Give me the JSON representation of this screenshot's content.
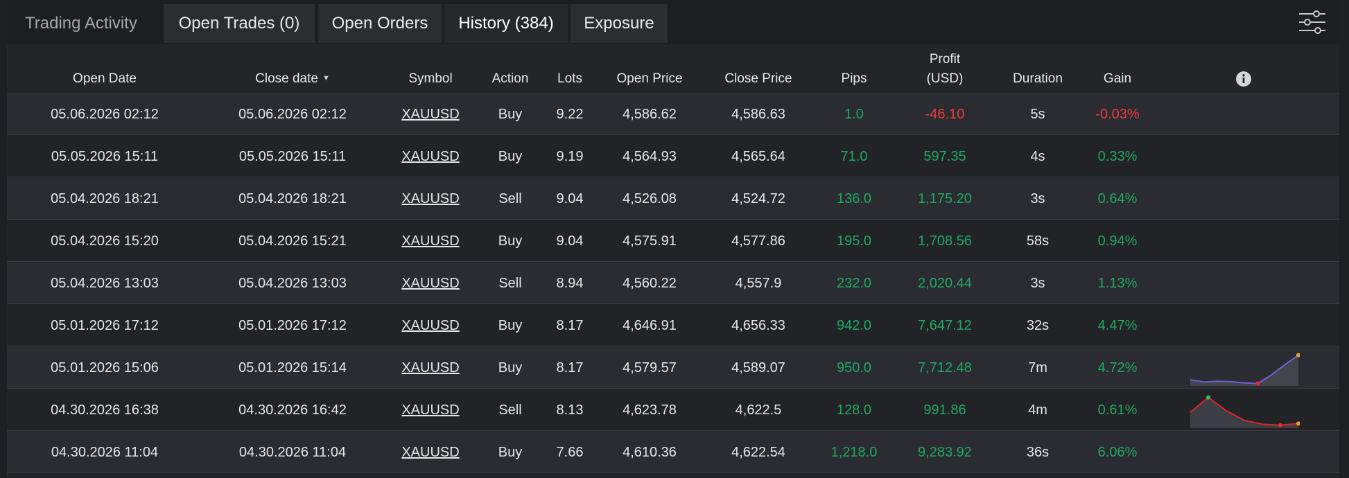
{
  "tabs": {
    "title": "Trading Activity",
    "open_trades": "Open Trades (0)",
    "open_orders": "Open Orders",
    "history": "History (384)",
    "exposure": "Exposure"
  },
  "columns": {
    "open_date": "Open Date",
    "close_date": "Close date",
    "symbol": "Symbol",
    "action": "Action",
    "lots": "Lots",
    "open_price": "Open Price",
    "close_price": "Close Price",
    "pips": "Pips",
    "profit_line1": "Profit",
    "profit_line2": "(USD)",
    "duration": "Duration",
    "gain": "Gain"
  },
  "colors": {
    "positive": "#1fa862",
    "negative": "#ee3b3b",
    "spark_up": "#6b63d9",
    "spark_down": "#d9262b"
  },
  "rows": [
    {
      "open_date": "05.06.2026 02:12",
      "close_date": "05.06.2026 02:12",
      "symbol": "XAUUSD",
      "action": "Buy",
      "lots": "9.22",
      "open_price": "4,586.62",
      "close_price": "4,586.63",
      "pips": "1.0",
      "profit": "-46.10",
      "duration": "5s",
      "gain": "-0.03%",
      "profit_sign": "neg",
      "pips_sign": "pos"
    },
    {
      "open_date": "05.05.2026 15:11",
      "close_date": "05.05.2026 15:11",
      "symbol": "XAUUSD",
      "action": "Buy",
      "lots": "9.19",
      "open_price": "4,564.93",
      "close_price": "4,565.64",
      "pips": "71.0",
      "profit": "597.35",
      "duration": "4s",
      "gain": "0.33%",
      "profit_sign": "pos",
      "pips_sign": "pos"
    },
    {
      "open_date": "05.04.2026 18:21",
      "close_date": "05.04.2026 18:21",
      "symbol": "XAUUSD",
      "action": "Sell",
      "lots": "9.04",
      "open_price": "4,526.08",
      "close_price": "4,524.72",
      "pips": "136.0",
      "profit": "1,175.20",
      "duration": "3s",
      "gain": "0.64%",
      "profit_sign": "pos",
      "pips_sign": "pos"
    },
    {
      "open_date": "05.04.2026 15:20",
      "close_date": "05.04.2026 15:21",
      "symbol": "XAUUSD",
      "action": "Buy",
      "lots": "9.04",
      "open_price": "4,575.91",
      "close_price": "4,577.86",
      "pips": "195.0",
      "profit": "1,708.56",
      "duration": "58s",
      "gain": "0.94%",
      "profit_sign": "pos",
      "pips_sign": "pos"
    },
    {
      "open_date": "05.04.2026 13:03",
      "close_date": "05.04.2026 13:03",
      "symbol": "XAUUSD",
      "action": "Sell",
      "lots": "8.94",
      "open_price": "4,560.22",
      "close_price": "4,557.9",
      "pips": "232.0",
      "profit": "2,020.44",
      "duration": "3s",
      "gain": "1.13%",
      "profit_sign": "pos",
      "pips_sign": "pos"
    },
    {
      "open_date": "05.01.2026 17:12",
      "close_date": "05.01.2026 17:12",
      "symbol": "XAUUSD",
      "action": "Buy",
      "lots": "8.17",
      "open_price": "4,646.91",
      "close_price": "4,656.33",
      "pips": "942.0",
      "profit": "7,647.12",
      "duration": "32s",
      "gain": "4.47%",
      "profit_sign": "pos",
      "pips_sign": "pos"
    },
    {
      "open_date": "05.01.2026 15:06",
      "close_date": "05.01.2026 15:14",
      "symbol": "XAUUSD",
      "action": "Buy",
      "lots": "8.17",
      "open_price": "4,579.57",
      "close_price": "4,589.07",
      "pips": "950.0",
      "profit": "7,712.48",
      "duration": "7m",
      "gain": "4.72%",
      "profit_sign": "pos",
      "pips_sign": "pos",
      "sparkline": "up"
    },
    {
      "open_date": "04.30.2026 16:38",
      "close_date": "04.30.2026 16:42",
      "symbol": "XAUUSD",
      "action": "Sell",
      "lots": "8.13",
      "open_price": "4,623.78",
      "close_price": "4,622.5",
      "pips": "128.0",
      "profit": "991.86",
      "duration": "4m",
      "gain": "0.61%",
      "profit_sign": "pos",
      "pips_sign": "pos",
      "sparkline": "down"
    },
    {
      "open_date": "04.30.2026 11:04",
      "close_date": "04.30.2026 11:04",
      "symbol": "XAUUSD",
      "action": "Buy",
      "lots": "7.66",
      "open_price": "4,610.36",
      "close_price": "4,622.54",
      "pips": "1,218.0",
      "profit": "9,283.92",
      "duration": "36s",
      "gain": "6.06%",
      "profit_sign": "pos",
      "pips_sign": "pos"
    }
  ],
  "sparklines": {
    "up": [
      0.85,
      0.92,
      0.9,
      0.91,
      0.95,
      0.97,
      0.7,
      0.38,
      0.08
    ],
    "down": [
      0.55,
      0.08,
      0.5,
      0.8,
      0.92,
      0.95,
      0.9
    ]
  }
}
